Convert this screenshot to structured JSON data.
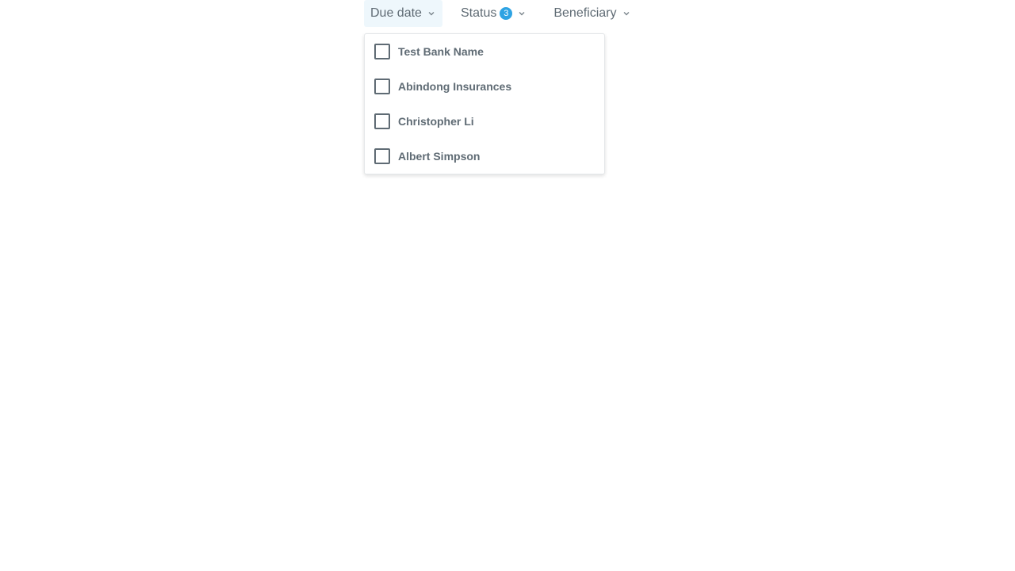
{
  "colors": {
    "text": "#5f6b74",
    "active_bg": "#eef7fc",
    "badge_bg": "#2ea3e3",
    "chevron": "#7a858c"
  },
  "filters": {
    "due_date": {
      "label": "Due date",
      "icon": "chevron-down-icon",
      "active": true
    },
    "status": {
      "label": "Status",
      "badge": "3",
      "icon": "chevron-down-icon"
    },
    "beneficiary": {
      "label": "Beneficiary",
      "icon": "chevron-down-icon"
    }
  },
  "dropdown": {
    "options": [
      {
        "label": "Test Bank Name",
        "checked": false
      },
      {
        "label": "Abindong Insurances",
        "checked": false
      },
      {
        "label": "Christopher Li",
        "checked": false
      },
      {
        "label": "Albert Simpson",
        "checked": false
      }
    ]
  }
}
